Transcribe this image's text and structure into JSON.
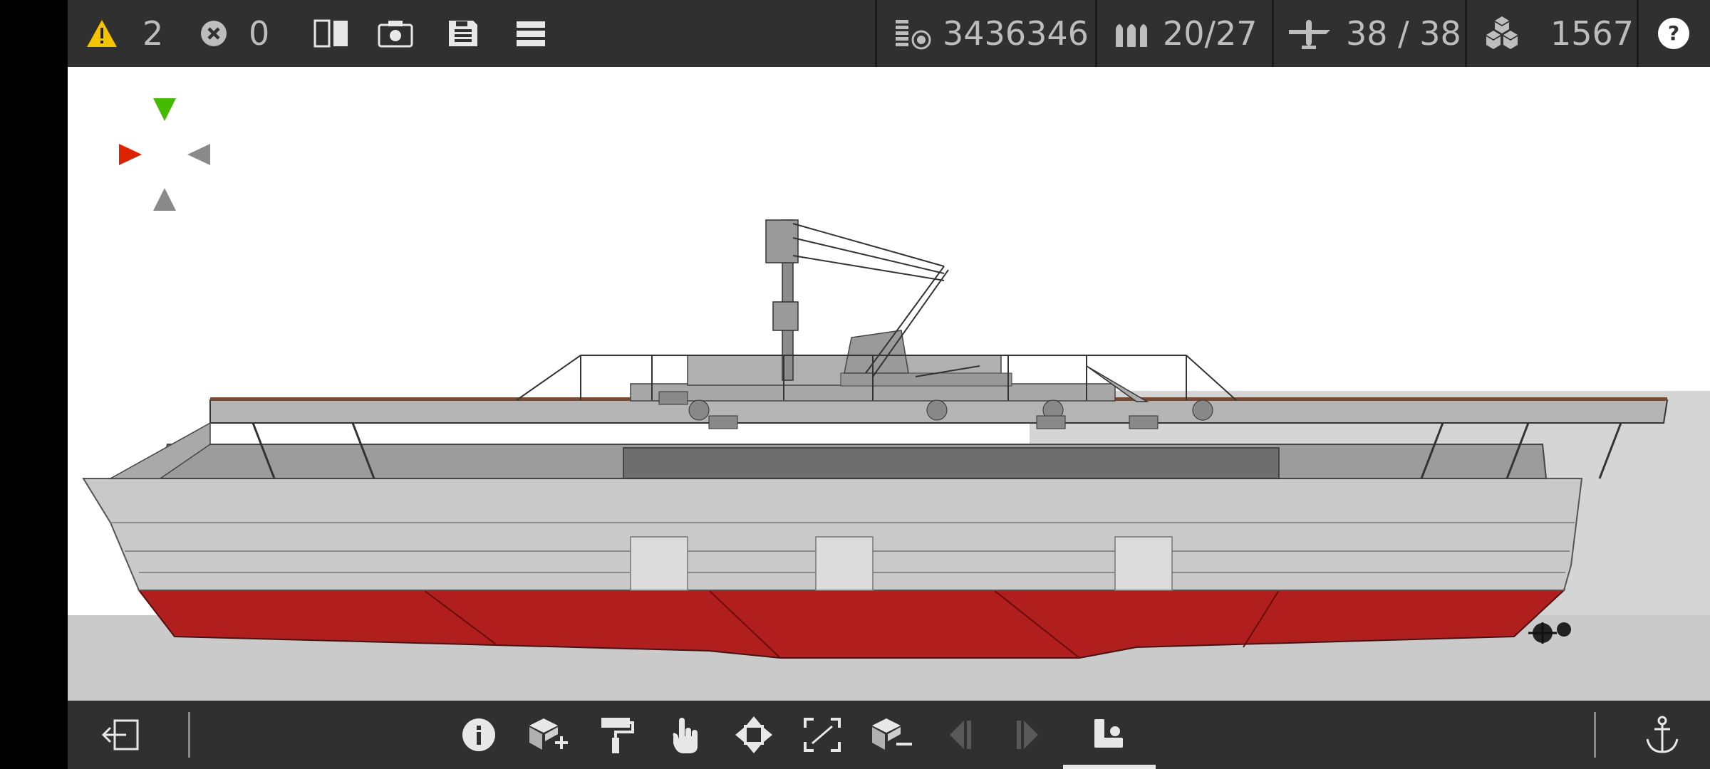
{
  "top_bar": {
    "warnings": {
      "icon": "warning-icon",
      "count": "2",
      "color": "#f5c400"
    },
    "errors": {
      "icon": "error-icon",
      "count": "0"
    },
    "tools": [
      {
        "icon": "mirror-icon"
      },
      {
        "icon": "camera-icon"
      },
      {
        "icon": "save-icon"
      },
      {
        "icon": "menu-icon"
      }
    ],
    "stats": {
      "cost": {
        "icon": "coins-icon",
        "value": "3436346"
      },
      "ammo": {
        "icon": "ammo-icon",
        "value": "20/27"
      },
      "aircraft": {
        "icon": "aircraft-icon",
        "value": "38 / 38"
      },
      "parts": {
        "icon": "parts-icon",
        "value": "1567"
      }
    },
    "help": {
      "icon": "help-icon"
    }
  },
  "viewport": {
    "orientation_gizmo": {
      "colors": {
        "green": "#44bb00",
        "red": "#dd2200",
        "grey": "#8a8a8a"
      }
    },
    "model": {
      "hull_color": "#c9c9c9",
      "keel_color": "#b01e1e"
    }
  },
  "bottom_bar": {
    "exit": {
      "icon": "exit-icon"
    },
    "tools": [
      {
        "icon": "info-icon"
      },
      {
        "icon": "add-block-icon"
      },
      {
        "icon": "paint-roller-icon"
      },
      {
        "icon": "hand-select-icon"
      },
      {
        "icon": "move-icon"
      },
      {
        "icon": "resize-icon"
      },
      {
        "icon": "remove-block-icon"
      },
      {
        "icon": "step-back-icon"
      },
      {
        "icon": "step-forward-icon"
      },
      {
        "icon": "crew-seat-icon"
      }
    ],
    "anchor": {
      "icon": "anchor-icon"
    }
  }
}
